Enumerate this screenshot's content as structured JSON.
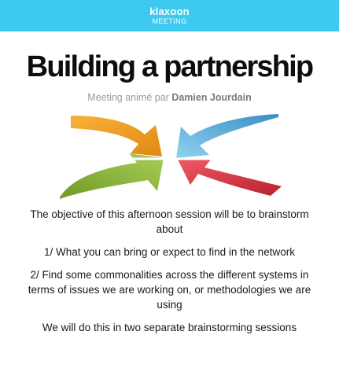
{
  "header": {
    "brand": "klaxoon",
    "product": "MEETING",
    "color": "#3ec9f0"
  },
  "meeting": {
    "title": "Building a partnership",
    "byline_prefix": "Meeting animé par",
    "host": "Damien Jourdain"
  },
  "image": {
    "icon": "converging-arrows-icon",
    "colors": {
      "orange": "#f5a623",
      "blue": "#5bb9e0",
      "green": "#8db53b",
      "red": "#e2414f"
    }
  },
  "description": {
    "paragraphs": [
      "The objective of this afternoon session will be to brainstorm about",
      "1/  What you can bring or expect to find in the network",
      "2/  Find some commonalities across the different systems in terms of issues we are working on, or methodologies we are using",
      "We will do this in two separate brainstorming sessions"
    ]
  }
}
